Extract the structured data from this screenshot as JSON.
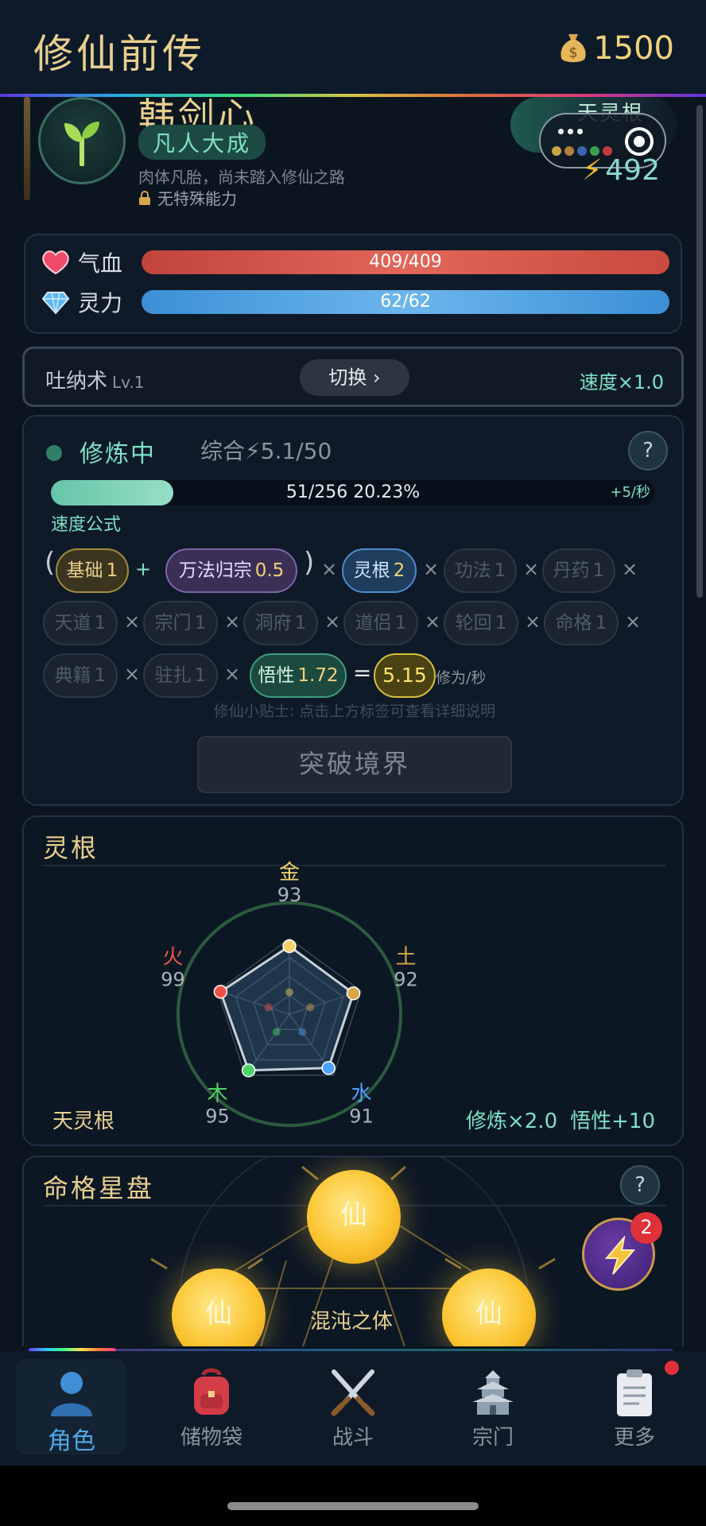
{
  "header": {
    "title": "修仙前传",
    "coins": "1500"
  },
  "character": {
    "name": "韩剑心",
    "realm": "凡人大成",
    "description": "肉体凡胎，尚未踏入修仙之路",
    "ability": "无特殊能力",
    "root_label": "天灵根",
    "power": "492"
  },
  "stats": {
    "hp_label": "气血",
    "hp_value": "409/409",
    "hp_ratio": 1.0,
    "mp_label": "灵力",
    "mp_value": "62/62",
    "mp_ratio": 1.0
  },
  "technique": {
    "name": "吐纳术",
    "level": "Lv.1",
    "switch_label": "切换 ›",
    "speed": "速度×1.0"
  },
  "cultivation": {
    "status": "修炼中",
    "overall": "综合⚡5.1/50",
    "help": "?",
    "progress_text": "51/256  20.23%",
    "progress_ratio": 0.2023,
    "rate": "+5/秒",
    "formula_label": "速度公式",
    "tags": {
      "base": {
        "label": "基础",
        "value": "1"
      },
      "wanfa": {
        "label": "万法归宗",
        "value": "0.5"
      },
      "root": {
        "label": "灵根",
        "value": "2"
      },
      "gongfa": {
        "label": "功法",
        "value": "1"
      },
      "danyao": {
        "label": "丹药",
        "value": "1"
      },
      "tiandao": {
        "label": "天道",
        "value": "1"
      },
      "zongmen": {
        "label": "宗门",
        "value": "1"
      },
      "dongfu": {
        "label": "洞府",
        "value": "1"
      },
      "daolv": {
        "label": "道侣",
        "value": "1"
      },
      "lunhui": {
        "label": "轮回",
        "value": "1"
      },
      "mingge": {
        "label": "命格",
        "value": "1"
      },
      "dianji": {
        "label": "典籍",
        "value": "1"
      },
      "zhuzha": {
        "label": "驻扎",
        "value": "1"
      },
      "wuxing": {
        "label": "悟性",
        "value": "1.72"
      },
      "result": {
        "value": "5.15"
      }
    },
    "ops": {
      "times": "×",
      "plus": "+",
      "equals": "=",
      "open": "(",
      "close": ")"
    },
    "unit": "修为/秒",
    "tip": "修仙小贴士: 点击上方标签可查看详细说明",
    "breakthrough": "突破境界"
  },
  "spirit_root": {
    "title": "灵根",
    "type": "天灵根",
    "bonus_cultivation": "修炼×2.0",
    "bonus_insight": "悟性+10",
    "elements": [
      {
        "name": "金",
        "value": "93",
        "color": "#f6d36a"
      },
      {
        "name": "土",
        "value": "92",
        "color": "#d9a64a"
      },
      {
        "name": "水",
        "value": "91",
        "color": "#4ea2ff"
      },
      {
        "name": "木",
        "value": "95",
        "color": "#4ed466"
      },
      {
        "name": "火",
        "value": "99",
        "color": "#ef5346"
      }
    ]
  },
  "star_disk": {
    "title": "命格星盘",
    "help": "?",
    "orb_text": "仙",
    "caption": "混沌之体",
    "fab_badge": "2"
  },
  "nav": {
    "items": [
      {
        "label": "角色",
        "icon": "person-icon"
      },
      {
        "label": "储物袋",
        "icon": "backpack-icon"
      },
      {
        "label": "战斗",
        "icon": "crossed-swords-icon"
      },
      {
        "label": "宗门",
        "icon": "pagoda-icon"
      },
      {
        "label": "更多",
        "icon": "clipboard-icon"
      }
    ]
  }
}
